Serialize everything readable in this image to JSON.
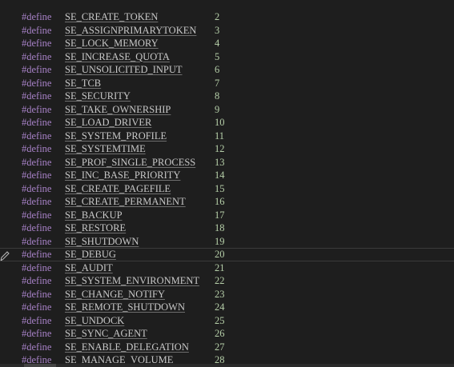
{
  "editor": {
    "keyword": "#define",
    "lines": [
      {
        "name": "SE_CREATE_TOKEN",
        "value": "2"
      },
      {
        "name": "SE_ASSIGNPRIMARYTOKEN",
        "value": "3"
      },
      {
        "name": "SE_LOCK_MEMORY",
        "value": "4"
      },
      {
        "name": "SE_INCREASE_QUOTA",
        "value": "5"
      },
      {
        "name": "SE_UNSOLICITED_INPUT",
        "value": "6"
      },
      {
        "name": "SE_TCB",
        "value": "7"
      },
      {
        "name": "SE_SECURITY",
        "value": "8"
      },
      {
        "name": "SE_TAKE_OWNERSHIP",
        "value": "9"
      },
      {
        "name": "SE_LOAD_DRIVER",
        "value": "10"
      },
      {
        "name": "SE_SYSTEM_PROFILE",
        "value": "11"
      },
      {
        "name": "SE_SYSTEMTIME",
        "value": "12"
      },
      {
        "name": "SE_PROF_SINGLE_PROCESS",
        "value": "13"
      },
      {
        "name": "SE_INC_BASE_PRIORITY",
        "value": "14"
      },
      {
        "name": "SE_CREATE_PAGEFILE",
        "value": "15"
      },
      {
        "name": "SE_CREATE_PERMANENT",
        "value": "16"
      },
      {
        "name": "SE_BACKUP",
        "value": "17"
      },
      {
        "name": "SE_RESTORE",
        "value": "18"
      },
      {
        "name": "SE_SHUTDOWN",
        "value": "19"
      },
      {
        "name": "SE_DEBUG",
        "value": "20",
        "current": true
      },
      {
        "name": "SE_AUDIT",
        "value": "21"
      },
      {
        "name": "SE_SYSTEM_ENVIRONMENT",
        "value": "22"
      },
      {
        "name": "SE_CHANGE_NOTIFY",
        "value": "23"
      },
      {
        "name": "SE_REMOTE_SHUTDOWN",
        "value": "24"
      },
      {
        "name": "SE_UNDOCK",
        "value": "25"
      },
      {
        "name": "SE_SYNC_AGENT",
        "value": "26"
      },
      {
        "name": "SE_ENABLE_DELEGATION",
        "value": "27"
      },
      {
        "name": "SE_MANAGE_VOLUME",
        "value": "28"
      }
    ],
    "gutter_icon": "pencil-icon"
  },
  "colors": {
    "background": "#1e1e1e",
    "keyword": "#a882c8",
    "identifier": "#c8c8c8",
    "number": "#b5cea8"
  }
}
